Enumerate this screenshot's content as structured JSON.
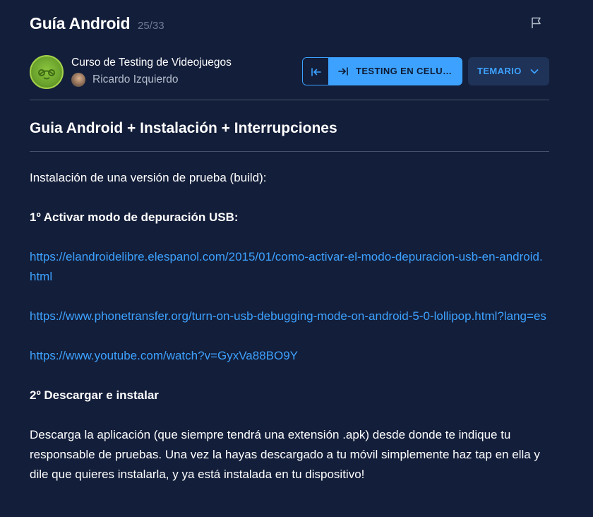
{
  "header": {
    "title": "Guía Android",
    "counter": "25/33"
  },
  "course": {
    "name": "Curso de Testing de Videojuegos",
    "teacher": "Ricardo Izquierdo"
  },
  "nav": {
    "next_label": "TESTING EN CELU…",
    "temario_label": "TEMARIO"
  },
  "lesson": {
    "title": "Guia Android + Instalación + Interrupciones",
    "intro": "Instalación de una versión de prueba (build):",
    "step1_heading": "1º Activar modo de depuración USB:",
    "links": [
      "https://elandroidelibre.elespanol.com/2015/01/como-activar-el-modo-depuracion-usb-en-android.html",
      "https://www.phonetransfer.org/turn-on-usb-debugging-mode-on-android-5-0-lollipop.html?lang=es",
      "https://www.youtube.com/watch?v=GyxVa88BO9Y"
    ],
    "step2_heading": "2º Descargar e instalar",
    "step2_text": "Descarga la aplicación (que siempre tendrá una extensión .apk) desde donde te indique tu responsable de pruebas. Una vez la hayas descargado a tu móvil simplemente haz tap en ella y dile que quieres instalarla, y ya está instalada en tu dispositivo!"
  },
  "colors": {
    "background": "#131e3a",
    "accent": "#3da2ff",
    "temario_bg": "#1f3258",
    "divider": "#46506a"
  },
  "icons": {
    "flag": "flag-icon",
    "prev": "arrow-left-bar-icon",
    "next": "arrow-right-bar-icon",
    "temario": "chevron-down-icon"
  }
}
